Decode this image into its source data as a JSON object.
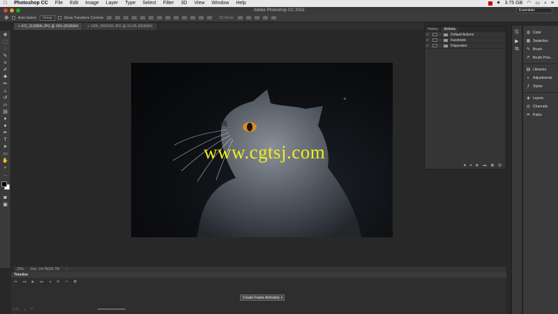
{
  "menubar": {
    "apple": "",
    "app": "Photoshop CC",
    "items": [
      "File",
      "Edit",
      "Image",
      "Layer",
      "Type",
      "Select",
      "Filter",
      "3D",
      "View",
      "Window",
      "Help"
    ],
    "memory": "3.75 GB",
    "status_icons": [
      "stop-icon",
      "star-icon",
      "wifi-icon",
      "battery-icon",
      "search-icon",
      "list-icon"
    ]
  },
  "window": {
    "title": "Adobe Photoshop CC 2015",
    "workspace": "Essentials"
  },
  "options": {
    "auto_select": "Auto-Select:",
    "group": "Group",
    "transform": "Show Transform Controls",
    "mode3d": "3D Mode:"
  },
  "tabs": [
    {
      "label": "473_3130896.JPG @ 25% (RGB/8#)"
    },
    {
      "label": "1300_5082253.JPG @ 33.3% (RGB/8#)"
    }
  ],
  "canvas": {
    "watermark": "www.cgtsj.com"
  },
  "status": {
    "zoom": "25%",
    "doc": "Doc: 24.7M/24.7M",
    "arrow": "›"
  },
  "timeline": {
    "title": "Timeline",
    "create_button": "Create Frame Animation",
    "dropdown": "▾"
  },
  "actions_panel": {
    "tabs": [
      "History",
      "Actions"
    ],
    "rows": [
      {
        "label": "Default Actions"
      },
      {
        "label": "Facebook"
      },
      {
        "label": "Dispersion"
      }
    ]
  },
  "right_panels": {
    "group1": [
      "Color",
      "Swatches",
      "Brush",
      "Brush Pres..."
    ],
    "group2": [
      "Libraries",
      "Adjustments",
      "Styles"
    ],
    "group3": [
      "Layers",
      "Channels",
      "Paths"
    ]
  },
  "colors": {
    "accent": "#f0ef1b",
    "bg": "#282828",
    "panel": "#3a3a3a"
  }
}
